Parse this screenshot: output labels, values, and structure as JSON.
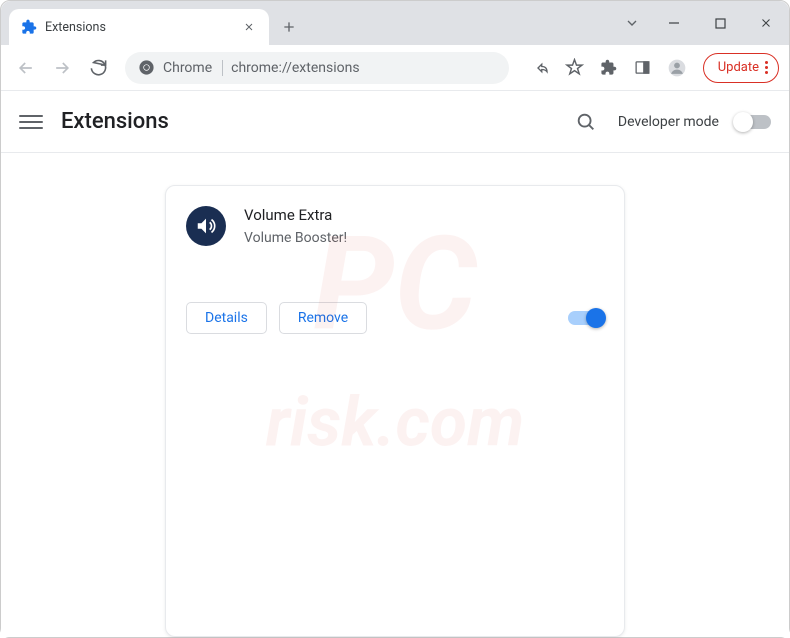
{
  "tab": {
    "title": "Extensions"
  },
  "address": {
    "prefix": "Chrome",
    "url": "chrome://extensions"
  },
  "update_button": {
    "label": "Update"
  },
  "page": {
    "title": "Extensions",
    "dev_mode_label": "Developer mode"
  },
  "extension": {
    "name": "Volume Extra",
    "description": "Volume Booster!",
    "details_label": "Details",
    "remove_label": "Remove",
    "enabled": true
  },
  "watermark": "PC\nrisk.com"
}
